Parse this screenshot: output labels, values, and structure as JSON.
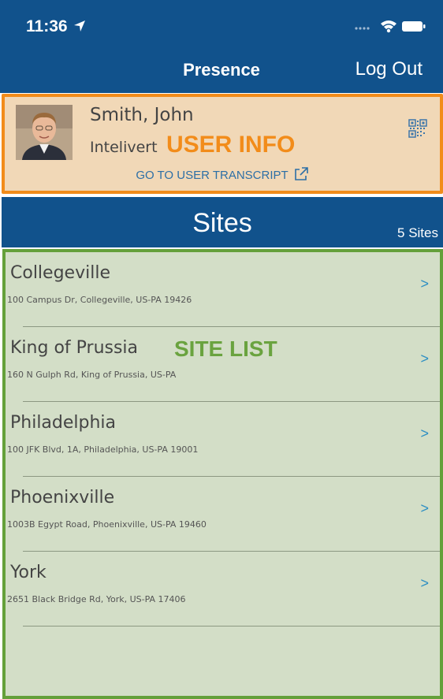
{
  "status_bar": {
    "time": "11:36",
    "icons": [
      "location-arrow-icon",
      "signal-dots-icon",
      "wifi-icon",
      "battery-icon"
    ]
  },
  "nav": {
    "title": "Presence",
    "logout_label": "Log Out"
  },
  "user": {
    "name": "Smith, John",
    "organization": "Intelivert",
    "annotation": "USER INFO",
    "transcript_link": "GO TO USER TRANSCRIPT",
    "icons": [
      "avatar-photo",
      "qr-code-icon",
      "external-link-icon"
    ]
  },
  "sites": {
    "title": "Sites",
    "count_label": "5 Sites",
    "annotation": "SITE LIST",
    "items": [
      {
        "name": "Collegeville",
        "address": "100 Campus Dr, Collegeville, US-PA 19426",
        "chevron": ">"
      },
      {
        "name": "King of Prussia",
        "address": "160 N Gulph Rd, King of Prussia, US-PA",
        "chevron": ">"
      },
      {
        "name": "Philadelphia",
        "address": "100 JFK Blvd, 1A, Philadelphia, US-PA 19001",
        "chevron": ">"
      },
      {
        "name": "Phoenixville",
        "address": "1003B Egypt Road, Phoenixville, US-PA 19460",
        "chevron": ">"
      },
      {
        "name": "York",
        "address": "2651 Black Bridge Rd, York, US-PA 17406",
        "chevron": ">"
      }
    ]
  },
  "colors": {
    "nav_background": "#11528c",
    "user_panel_background": "#f1d8b7",
    "user_panel_border": "#f28c1a",
    "site_panel_background": "#d3dec7",
    "site_panel_border": "#64a03a",
    "link": "#2d6fa6",
    "chevron": "#2e8fc3"
  }
}
